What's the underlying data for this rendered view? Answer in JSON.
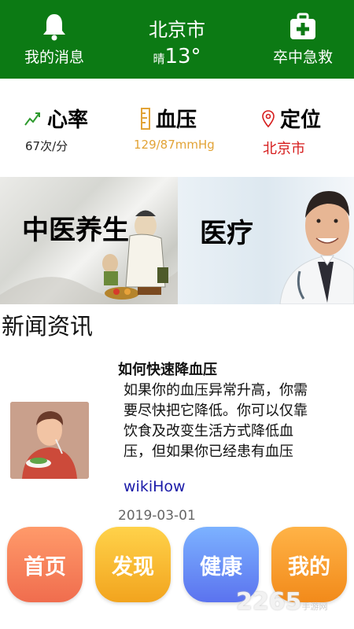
{
  "header": {
    "messages_label": "我的消息",
    "city": "北京市",
    "weather_condition": "晴",
    "temperature": "13°",
    "emergency_label": "卒中急救"
  },
  "stats": [
    {
      "title": "心率",
      "value": "67次/分",
      "icon": "heart-rate-icon",
      "accent": "#2e9a2e"
    },
    {
      "title": "血压",
      "value": "129/87mmHg",
      "icon": "ruler-icon",
      "accent": "#e2a336"
    },
    {
      "title": "定位",
      "value": "北京市",
      "icon": "location-pin-icon",
      "accent": "#d61d1d"
    }
  ],
  "banners": [
    {
      "label": "中医养生"
    },
    {
      "label": "医疗"
    }
  ],
  "news": {
    "section_title": "新闻资讯",
    "article": {
      "title": "如何快速降血压",
      "body": "如果你的血压异常升高，你需要尽快把它降低。你可以仅靠饮食及改变生活方式降低血压，但如果你已经患有血压",
      "source": "wikiHow",
      "date": "2019-03-01"
    }
  },
  "nav": [
    {
      "label": "首页"
    },
    {
      "label": "发现"
    },
    {
      "label": "健康"
    },
    {
      "label": "我的"
    }
  ],
  "watermark": {
    "brand": "2265",
    "sub": "手游网"
  },
  "colors": {
    "header_bg": "#0c7a14",
    "source_link": "#1a1aa8"
  }
}
